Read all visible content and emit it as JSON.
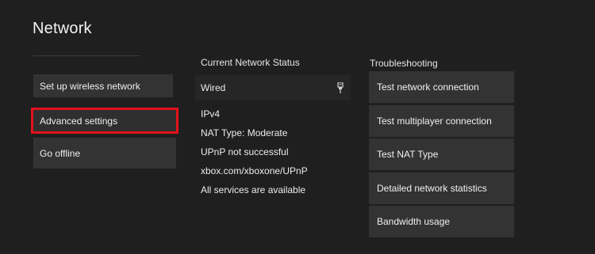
{
  "header": {
    "title": "Network"
  },
  "left_menu": {
    "items": [
      {
        "label": "Set up wireless network"
      },
      {
        "label": "Advanced settings",
        "selected": true
      },
      {
        "label": "Go offline"
      }
    ]
  },
  "status": {
    "header": "Current Network Status",
    "connection": "Wired",
    "connection_icon": "ethernet-plug-icon",
    "lines": [
      "IPv4",
      "NAT Type: Moderate",
      "UPnP not successful",
      "xbox.com/xboxone/UPnP",
      "All services are available"
    ]
  },
  "troubleshooting": {
    "header": "Troubleshooting",
    "items": [
      {
        "label": "Test network connection"
      },
      {
        "label": "Test multiplayer connection"
      },
      {
        "label": "Test NAT Type"
      },
      {
        "label": "Detailed network statistics"
      },
      {
        "label": "Bandwidth usage"
      }
    ]
  },
  "colors": {
    "background": "#1f1f1f",
    "tile": "#333333",
    "selection_outline": "#e3121b"
  }
}
